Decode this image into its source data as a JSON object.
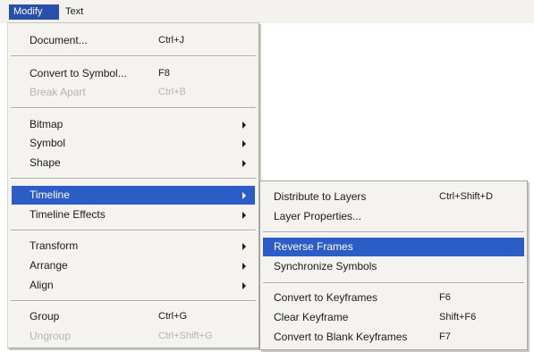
{
  "menubar": {
    "modify": "Modify",
    "text": "Text"
  },
  "modify_menu": {
    "document": {
      "label": "Document...",
      "shortcut": "Ctrl+J"
    },
    "convert_to_symbol": {
      "label": "Convert to Symbol...",
      "shortcut": "F8"
    },
    "break_apart": {
      "label": "Break Apart",
      "shortcut": "Ctrl+B"
    },
    "bitmap": {
      "label": "Bitmap"
    },
    "symbol": {
      "label": "Symbol"
    },
    "shape": {
      "label": "Shape"
    },
    "timeline": {
      "label": "Timeline"
    },
    "timeline_effects": {
      "label": "Timeline Effects"
    },
    "transform": {
      "label": "Transform"
    },
    "arrange": {
      "label": "Arrange"
    },
    "align": {
      "label": "Align"
    },
    "group": {
      "label": "Group",
      "shortcut": "Ctrl+G"
    },
    "ungroup": {
      "label": "Ungroup",
      "shortcut": "Ctrl+Shift+G"
    }
  },
  "timeline_submenu": {
    "distribute_to_layers": {
      "label": "Distribute to Layers",
      "shortcut": "Ctrl+Shift+D"
    },
    "layer_properties": {
      "label": "Layer Properties..."
    },
    "reverse_frames": {
      "label": "Reverse Frames"
    },
    "synchronize_symbols": {
      "label": "Synchronize Symbols"
    },
    "convert_to_keyframes": {
      "label": "Convert to Keyframes",
      "shortcut": "F6"
    },
    "clear_keyframe": {
      "label": "Clear Keyframe",
      "shortcut": "Shift+F6"
    },
    "convert_to_blank_keyframes": {
      "label": "Convert to Blank Keyframes",
      "shortcut": "F7"
    }
  },
  "colors": {
    "highlight": "#2c5cc5",
    "menubar_active": "#2950a8",
    "menu_background": "#f4f3ef",
    "disabled_text": "#b5b4b0"
  }
}
